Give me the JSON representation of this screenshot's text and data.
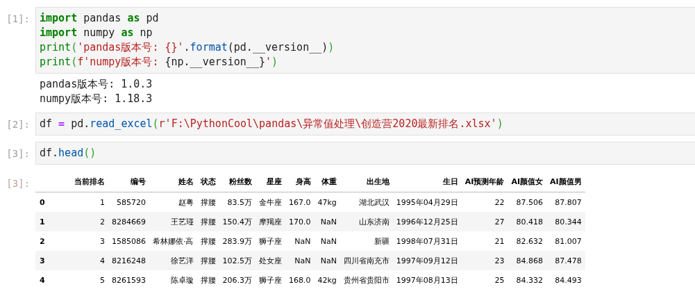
{
  "cells": [
    {
      "prompt": "[1]:",
      "code": [
        [
          {
            "kind": "keyword",
            "text": "import"
          },
          {
            "kind": "plain",
            "text": " pandas "
          },
          {
            "kind": "keyword",
            "text": "as"
          },
          {
            "kind": "plain",
            "text": " pd"
          }
        ],
        [
          {
            "kind": "keyword",
            "text": "import"
          },
          {
            "kind": "plain",
            "text": " numpy "
          },
          {
            "kind": "keyword",
            "text": "as"
          },
          {
            "kind": "plain",
            "text": " np"
          }
        ],
        [
          {
            "kind": "builtin",
            "text": "print"
          },
          {
            "kind": "paren",
            "text": "("
          },
          {
            "kind": "string",
            "text": "'pandas版本号: {}'"
          },
          {
            "kind": "plain",
            "text": "."
          },
          {
            "kind": "method",
            "text": "format"
          },
          {
            "kind": "plain",
            "text": "(pd.__version__)"
          },
          {
            "kind": "paren",
            "text": ")"
          }
        ],
        [
          {
            "kind": "builtin",
            "text": "print"
          },
          {
            "kind": "paren",
            "text": "("
          },
          {
            "kind": "string",
            "text": "f'numpy版本号: "
          },
          {
            "kind": "plain",
            "text": "{np.__version__}"
          },
          {
            "kind": "string",
            "text": "'"
          },
          {
            "kind": "paren",
            "text": ")"
          }
        ]
      ],
      "output": [
        "pandas版本号: 1.0.3",
        "numpy版本号: 1.18.3"
      ]
    },
    {
      "prompt": "[2]:",
      "code": [
        [
          {
            "kind": "plain",
            "text": "df "
          },
          {
            "kind": "operator",
            "text": "="
          },
          {
            "kind": "plain",
            "text": " pd."
          },
          {
            "kind": "method",
            "text": "read_excel"
          },
          {
            "kind": "paren",
            "text": "("
          },
          {
            "kind": "string",
            "text": "r'F:\\PythonCool\\pandas\\异常值处理\\创造营2020最新排名.xlsx'"
          },
          {
            "kind": "paren",
            "text": ")"
          }
        ]
      ]
    },
    {
      "prompt": "[3]:",
      "code": [
        [
          {
            "kind": "plain",
            "text": "df."
          },
          {
            "kind": "method",
            "text": "head"
          },
          {
            "kind": "paren",
            "text": "()"
          }
        ]
      ]
    }
  ],
  "result": {
    "prompt": "[3]:",
    "table": {
      "columns": [
        "当前排名",
        "编号",
        "姓名",
        "状态",
        "粉丝数",
        "星座",
        "身高",
        "体重",
        "出生地",
        "生日",
        "AI预测年龄",
        "AI颜值女",
        "AI颜值男"
      ],
      "rows": [
        {
          "index": "0",
          "cells": [
            "1",
            "585720",
            "赵粤",
            "撑腰",
            "83.5万",
            "金牛座",
            "167.0",
            "47kg",
            "湖北武汉",
            "1995年04月29日",
            "22",
            "87.506",
            "87.807"
          ]
        },
        {
          "index": "1",
          "cells": [
            "2",
            "8284669",
            "王艺瑾",
            "撑腰",
            "150.4万",
            "摩羯座",
            "170.0",
            "NaN",
            "山东济南",
            "1996年12月25日",
            "27",
            "80.418",
            "80.344"
          ]
        },
        {
          "index": "2",
          "cells": [
            "3",
            "1585086",
            "希林娜依·高",
            "撑腰",
            "283.9万",
            "狮子座",
            "NaN",
            "NaN",
            "新疆",
            "1998年07月31日",
            "21",
            "82.632",
            "81.007"
          ]
        },
        {
          "index": "3",
          "cells": [
            "4",
            "8216248",
            "徐艺洋",
            "撑腰",
            "102.5万",
            "处女座",
            "NaN",
            "NaN",
            "四川省南充市",
            "1997年09月12日",
            "23",
            "84.868",
            "87.478"
          ]
        },
        {
          "index": "4",
          "cells": [
            "5",
            "8261593",
            "陈卓璇",
            "撑腰",
            "206.3万",
            "狮子座",
            "168.0",
            "42kg",
            "贵州省贵阳市",
            "1997年08月13日",
            "25",
            "84.332",
            "84.493"
          ]
        }
      ]
    }
  }
}
